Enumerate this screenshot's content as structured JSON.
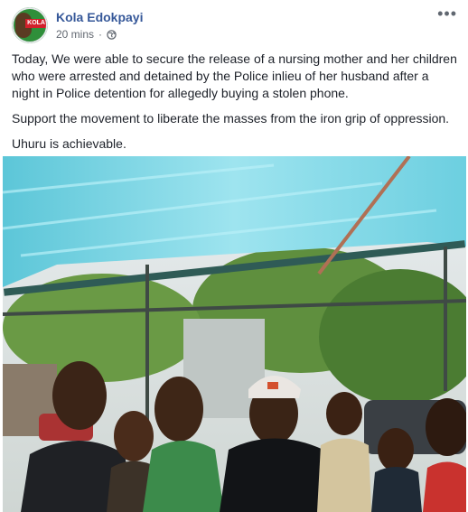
{
  "post": {
    "author": "Kola Edokpayi",
    "timestamp": "20 mins",
    "privacy_icon": "globe-icon",
    "menu_icon": "more-options-icon",
    "avatar_badge_text": "KOLA",
    "paragraphs": [
      "Today, We were able to secure the release of a nursing mother and her children who were arrested and detained by the Police inlieu of her husband after a night in Police detention for allegedly buying a stolen phone.",
      "Support the movement to liberate the masses from the iron grip of oppression.",
      "Uhuru is achievable."
    ]
  },
  "colors": {
    "author_link": "#365899",
    "meta_text": "#616770",
    "canopy": "#7fd7e6"
  }
}
